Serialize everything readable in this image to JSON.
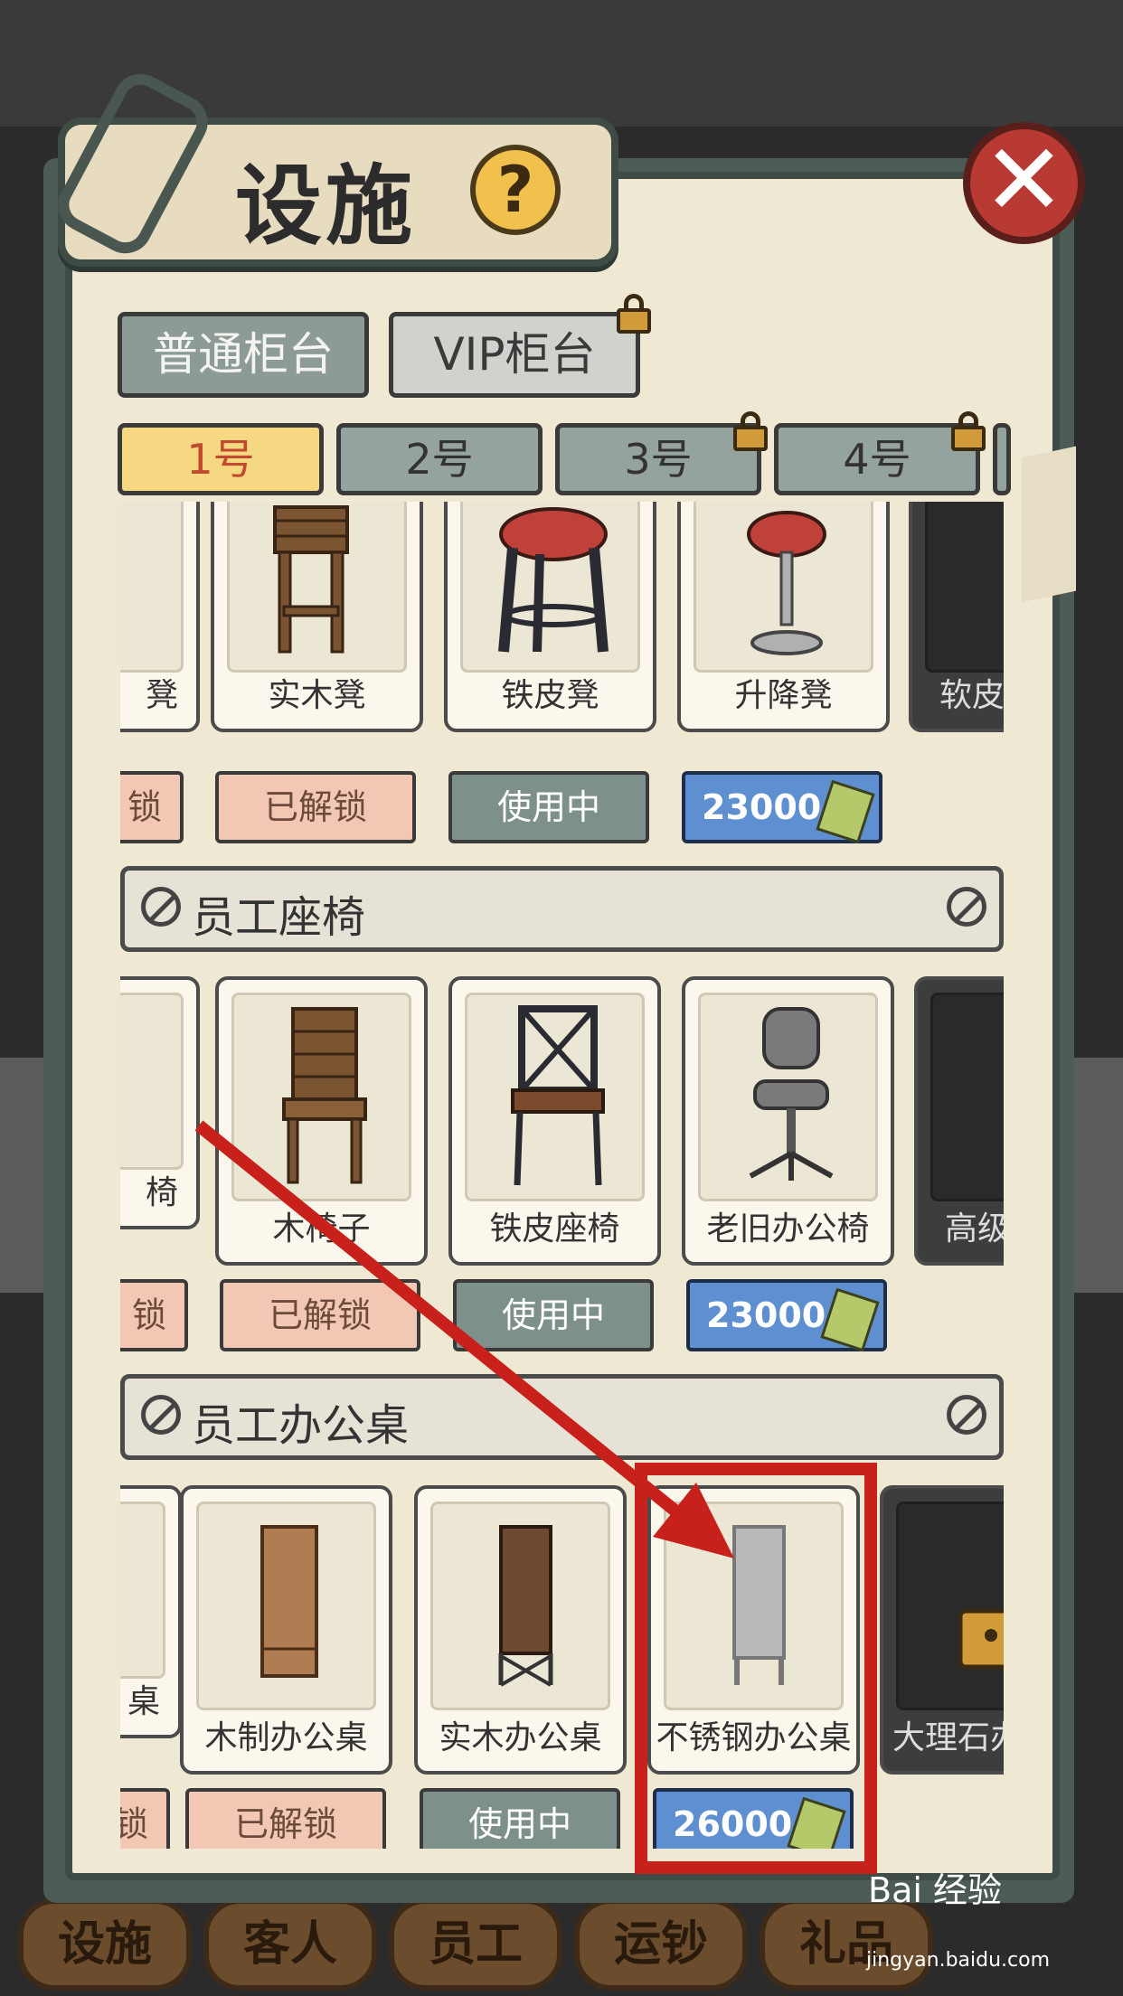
{
  "title": "设施",
  "help_label": "?",
  "close_label": "✕",
  "counter_tabs": [
    {
      "label": "普通柜台",
      "locked": false
    },
    {
      "label": "VIP柜台",
      "locked": true
    }
  ],
  "number_tabs": [
    {
      "label": "1号",
      "active": true,
      "locked": false
    },
    {
      "label": "2号",
      "active": false,
      "locked": false
    },
    {
      "label": "3号",
      "active": false,
      "locked": true
    },
    {
      "label": "4号",
      "active": false,
      "locked": true
    }
  ],
  "rows": [
    {
      "section": "",
      "partial_label": "凳",
      "partial_status": "锁",
      "items": [
        {
          "label": "实木凳",
          "status": "已解锁",
          "kind": "unlocked"
        },
        {
          "label": "铁皮凳",
          "status": "使用中",
          "kind": "inuse"
        },
        {
          "label": "升降凳",
          "status": "23000",
          "kind": "price"
        },
        {
          "label": "软皮",
          "status": "",
          "kind": "locked"
        }
      ]
    },
    {
      "section": "员工座椅",
      "partial_label": "椅",
      "partial_status": "锁",
      "items": [
        {
          "label": "木椅子",
          "status": "已解锁",
          "kind": "unlocked"
        },
        {
          "label": "铁皮座椅",
          "status": "使用中",
          "kind": "inuse"
        },
        {
          "label": "老旧办公椅",
          "status": "23000",
          "kind": "price"
        },
        {
          "label": "高级",
          "status": "",
          "kind": "locked"
        }
      ]
    },
    {
      "section": "员工办公桌",
      "partial_label": "桌",
      "partial_status": "锁",
      "items": [
        {
          "label": "木制办公桌",
          "status": "已解锁",
          "kind": "unlocked"
        },
        {
          "label": "实木办公桌",
          "status": "使用中",
          "kind": "inuse"
        },
        {
          "label": "不锈钢办公桌",
          "status": "26000",
          "kind": "price"
        },
        {
          "label": "大理石办",
          "status": "",
          "kind": "locked"
        }
      ]
    }
  ],
  "bottom_nav": [
    "设施",
    "客人",
    "员工",
    "运钞",
    "礼品"
  ],
  "watermark": {
    "brand": "Bai 经验",
    "url": "jingyan.baidu.com"
  },
  "colors": {
    "accent_red": "#c8201b",
    "tab_active": "#f6d883",
    "price_blue": "#5e8fd0"
  }
}
